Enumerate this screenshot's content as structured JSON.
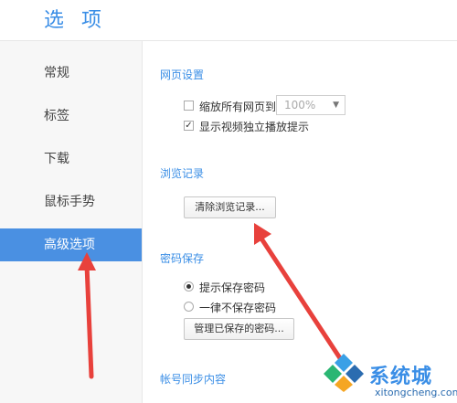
{
  "window": {
    "title": "选 项"
  },
  "sidebar": {
    "items": [
      {
        "label": "常规"
      },
      {
        "label": "标签"
      },
      {
        "label": "下载"
      },
      {
        "label": "鼠标手势"
      },
      {
        "label": "高级选项",
        "active": true
      }
    ]
  },
  "sections": {
    "webpage": {
      "title": "网页设置",
      "zoom_label": "缩放所有网页到",
      "zoom_value": "100%",
      "video_label": "显示视频独立播放提示"
    },
    "history": {
      "title": "浏览记录",
      "clear_button": "清除浏览记录..."
    },
    "password": {
      "title": "密码保存",
      "prompt_label": "提示保存密码",
      "never_label": "一律不保存密码",
      "manage_button": "管理已保存的密码..."
    },
    "sync": {
      "title": "帐号同步内容"
    }
  },
  "watermark": {
    "brand": "系统城",
    "url": "xitongcheng.com"
  },
  "colors": {
    "accent": "#4a90e2",
    "arrow": "#e8413c"
  }
}
